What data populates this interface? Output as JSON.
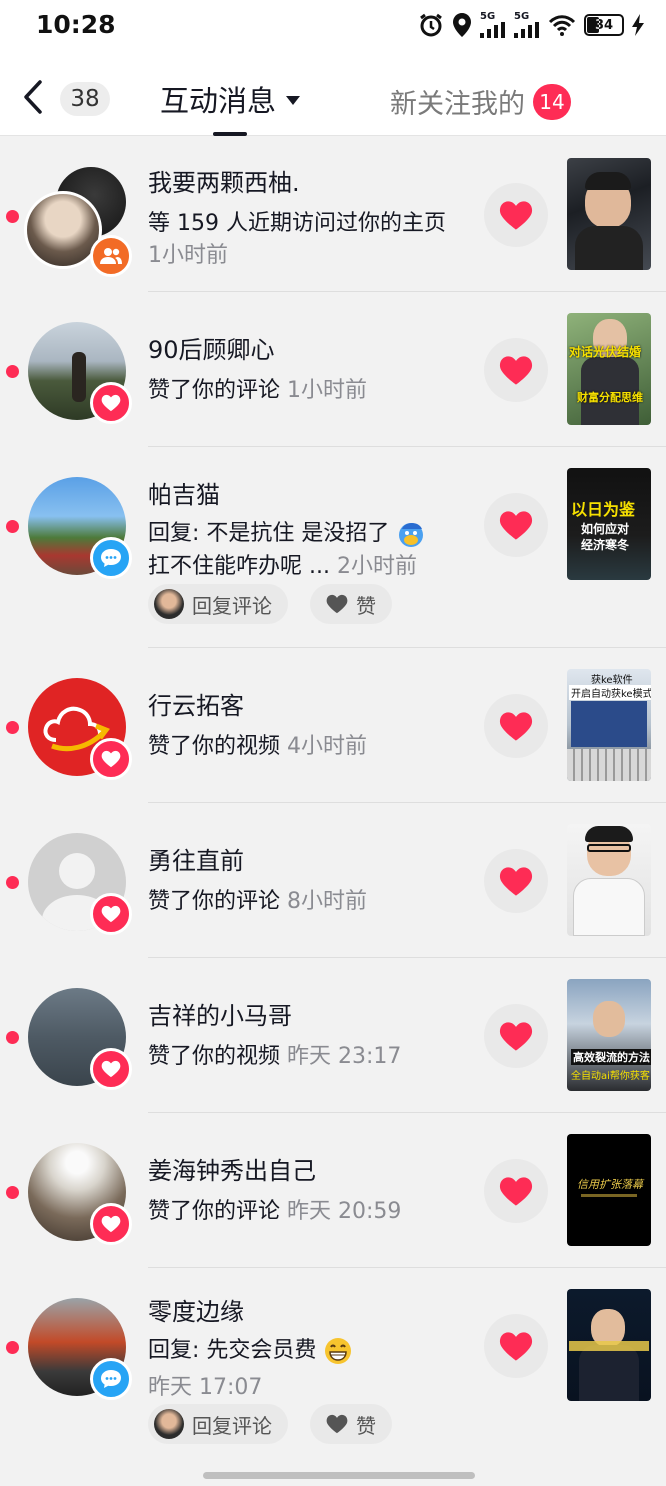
{
  "status_bar": {
    "time": "10:28",
    "network_1": "5G",
    "network_2": "5G",
    "battery": "34",
    "icons": [
      "alarm-icon",
      "location-icon",
      "signal-icon",
      "signal-icon",
      "wifi-icon",
      "battery-icon",
      "charging-icon"
    ]
  },
  "nav": {
    "back_count": "38",
    "active_tab": "互动消息",
    "other_tab": "新关注我的",
    "other_tab_badge": "14"
  },
  "notifications": [
    {
      "name": "我要两颗西柚.",
      "line1": "等 159 人近期访问过你的主页",
      "line1_meta": "",
      "line2": "1小时前",
      "badge": "follow-badge-icon",
      "unread": true
    },
    {
      "name": "90后顾卿心",
      "line1": "赞了你的评论",
      "line1_meta": "1小时前",
      "badge": "heart-badge-icon",
      "unread": true,
      "thumb_text_1": "对话光伏结婚",
      "thumb_text_2": "财富分配思维"
    },
    {
      "name": "帕吉猫",
      "line1": "回复: 不是抗住 是没招了",
      "line2": "扛不住能咋办呢 ...",
      "line2_meta": "2小时前",
      "badge": "comment-badge-icon",
      "unread": true,
      "thumb_text_1": "以日为鉴",
      "thumb_text_2": "如何应对",
      "thumb_text_3": "经济寒冬",
      "reply_chip": "回复评论",
      "like_chip": "赞"
    },
    {
      "name": "行云拓客",
      "line1": "赞了你的视频",
      "line1_meta": "4小时前",
      "badge": "heart-badge-icon",
      "unread": true,
      "thumb_text_1": "获ke软件",
      "thumb_text_2": "开启自动获ke模式"
    },
    {
      "name": "勇往直前",
      "line1": "赞了你的评论",
      "line1_meta": "8小时前",
      "badge": "heart-badge-icon",
      "unread": true
    },
    {
      "name": "吉祥的小马哥",
      "line1": "赞了你的视频",
      "line1_meta": "昨天 23:17",
      "badge": "heart-badge-icon",
      "unread": true,
      "thumb_text_1": "高效裂流的方法",
      "thumb_text_2": "全自动ai帮你获客"
    },
    {
      "name": "姜海钟秀出自己",
      "line1": "赞了你的评论",
      "line1_meta": "昨天 20:59",
      "badge": "heart-badge-icon",
      "unread": true,
      "thumb_text_1": "信用扩张落幕"
    },
    {
      "name": "零度边缘",
      "line1": "回复: 先交会员费",
      "line2": "昨天 17:07",
      "badge": "comment-badge-icon",
      "unread": true,
      "reply_chip": "回复评论",
      "like_chip": "赞"
    }
  ],
  "colors": {
    "accent_red": "#fe2c55",
    "reply_blue": "#27a4f5",
    "follow_orange": "#f26b26",
    "background": "#f2f2f2"
  }
}
